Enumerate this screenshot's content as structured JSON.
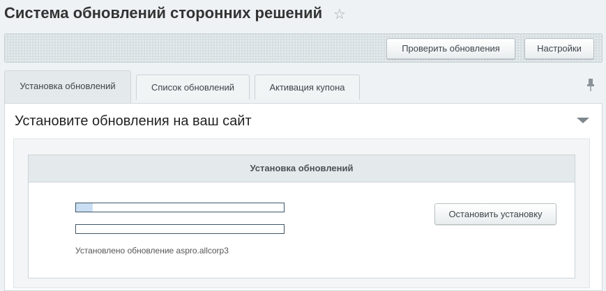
{
  "page": {
    "title": "Система обновлений сторонних решений"
  },
  "toolbar": {
    "check_updates_label": "Проверить обновления",
    "settings_label": "Настройки"
  },
  "tabs": [
    {
      "label": "Установка обновлений",
      "active": true
    },
    {
      "label": "Список обновлений",
      "active": false
    },
    {
      "label": "Активация купона",
      "active": false
    }
  ],
  "section": {
    "title": "Установите обновления на ваш сайт"
  },
  "install_box": {
    "header": "Установка обновлений",
    "progress_primary": 0.08,
    "progress_secondary": 0,
    "status": "Установлено обновление aspro.allcorp3",
    "stop_label": "Остановить установку"
  },
  "colors": {
    "progress_fill": "#c9def2",
    "progress_border": "#3e5566"
  },
  "icons": {
    "favorite": "star-icon",
    "pin": "pin-icon",
    "collapse": "chevron-down-icon"
  }
}
